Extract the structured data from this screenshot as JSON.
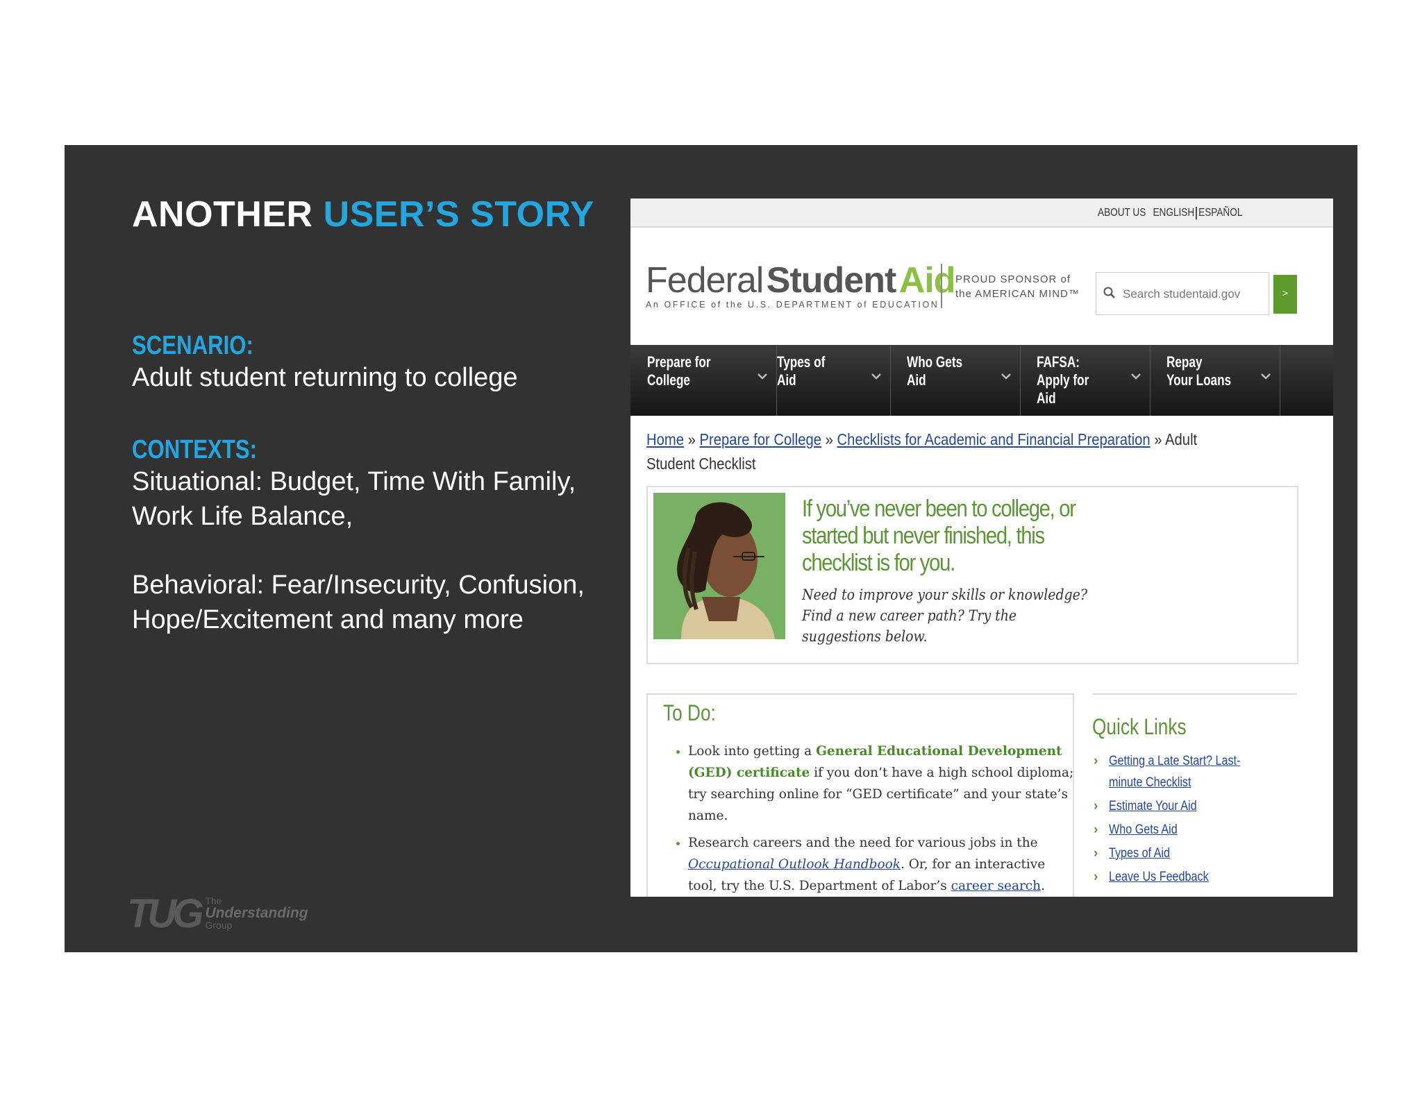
{
  "slide": {
    "title_part1": "ANOTHER ",
    "title_part2": "USER’S STORY",
    "scenario_label": "SCENARIO:",
    "scenario_text": "Adult student returning to college",
    "contexts_label": "CONTEXTS:",
    "situational_line1": "Situational: Budget, Time With Family,",
    "situational_line2": "Work Life Balance,",
    "behavioral_line1": "Behavioral: Fear/Insecurity, Confusion,",
    "behavioral_line2": "Hope/Excitement and many more",
    "logo": {
      "mark": "TUG",
      "the": "The",
      "understanding": "Understanding",
      "group": "Group"
    },
    "colors": {
      "accent": "#22a7e0",
      "background": "#333233"
    }
  },
  "site": {
    "top_links": {
      "about": "ABOUT US",
      "english": "ENGLISH",
      "espanol": "ESPAÑOL"
    },
    "brand": {
      "word1": "Federal",
      "word2": "Student",
      "word3": "Aid",
      "subtitle": "An OFFICE of the U.S. DEPARTMENT of EDUCATION"
    },
    "sponsor": {
      "line1": "PROUD SPONSOR of",
      "line2": "the AMERICAN MIND™"
    },
    "search": {
      "placeholder": "Search studentaid.gov",
      "go_label": ">",
      "icon": "search-icon"
    },
    "nav": [
      {
        "label": "Prepare for College"
      },
      {
        "label": "Types of Aid"
      },
      {
        "label": "Who Gets Aid"
      },
      {
        "label": "FAFSA: Apply for Aid"
      },
      {
        "label": "Repay Your Loans"
      }
    ],
    "breadcrumb": {
      "home": "Home",
      "sep": " » ",
      "prepare": "Prepare for College",
      "checklists": "Checklists for Academic and Financial Preparation",
      "current": "Adult Student Checklist"
    },
    "hero": {
      "headline": "If you’ve never been to college, or started but never finished, this checklist is for you.",
      "subtext": "Need to improve your skills or knowledge? Find a new career path? Try the suggestions below."
    },
    "todo": {
      "heading": "To Do:",
      "item1_pre": "Look into getting a ",
      "item1_bold": "General Educational Development (GED) certificate",
      "item1_post": " if you don’t have a high school diploma; try searching online for “GED certificate” and your state’s name.",
      "item2_pre": "Research careers and the need for various jobs in the ",
      "item2_link": "Occupational Outlook Handbook",
      "item2_mid": ". Or, for an interactive tool, try the U.S. Department of Labor’s ",
      "item2_link2": "career search",
      "item2_post": "."
    },
    "quick_links": {
      "heading": "Quick Links",
      "items": [
        "Getting a Late Start? Last-minute Checklist",
        "Estimate Your Aid",
        "Who Gets Aid",
        "Types of Aid",
        "Leave Us Feedback"
      ]
    }
  }
}
